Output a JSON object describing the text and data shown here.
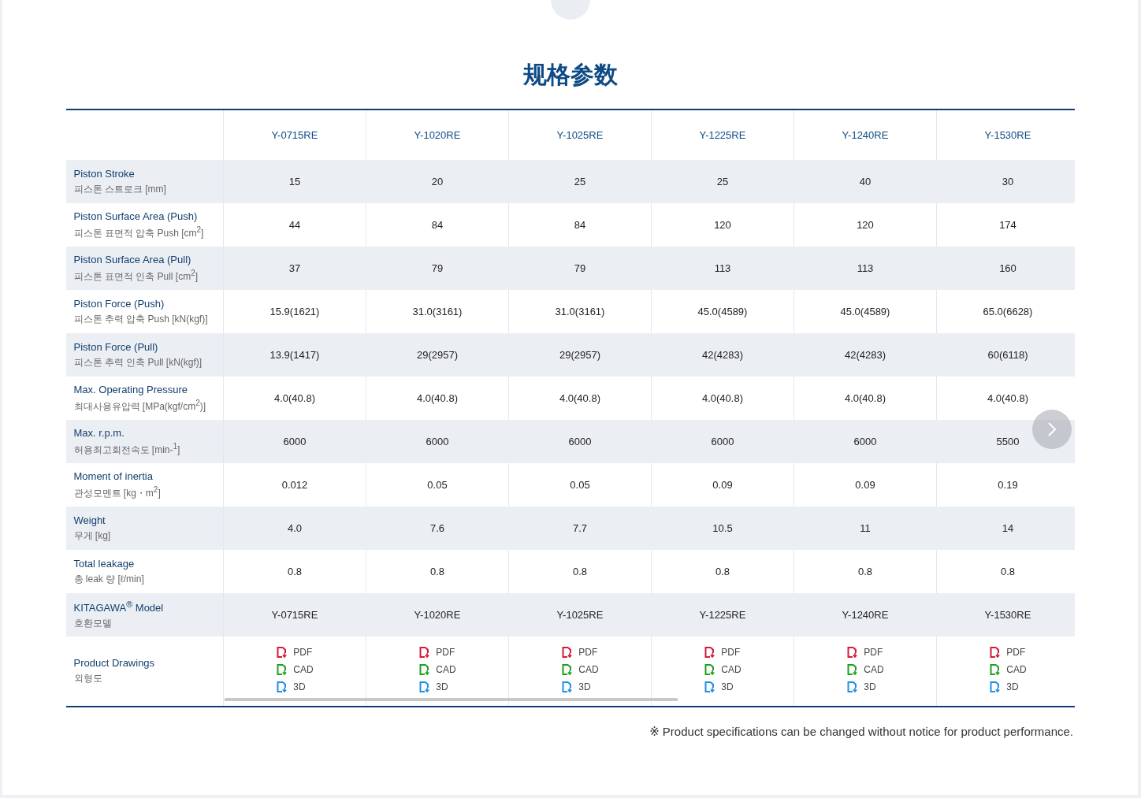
{
  "title": "规格参数",
  "columns": [
    "Y-0715RE",
    "Y-1020RE",
    "Y-1025RE",
    "Y-1225RE",
    "Y-1240RE",
    "Y-1530RE"
  ],
  "rows": [
    {
      "label": "Piston Stroke",
      "sublabel": "피스톤 스트로크 [mm]",
      "values": [
        "15",
        "20",
        "25",
        "25",
        "40",
        "30"
      ]
    },
    {
      "label": "Piston Surface Area (Push)",
      "sublabel": "피스톤 표면적 압축 Push [cm$^{2}$]",
      "values": [
        "44",
        "84",
        "84",
        "120",
        "120",
        "174"
      ]
    },
    {
      "label": "Piston Surface Area (Pull)",
      "sublabel": "피스톤 표면적 인축 Pull [cm$^{2}$]",
      "values": [
        "37",
        "79",
        "79",
        "113",
        "113",
        "160"
      ]
    },
    {
      "label": "Piston Force (Push)",
      "sublabel": "피스톤 추력 압축 Push [kN(kgf)]",
      "values": [
        "15.9(1621)",
        "31.0(3161)",
        "31.0(3161)",
        "45.0(4589)",
        "45.0(4589)",
        "65.0(6628)"
      ]
    },
    {
      "label": "Piston Force (Pull)",
      "sublabel": "피스톤 추력 인축 Pull [kN(kgf)]",
      "values": [
        "13.9(1417)",
        "29(2957)",
        "29(2957)",
        "42(4283)",
        "42(4283)",
        "60(6118)"
      ]
    },
    {
      "label": "Max. Operating Pressure",
      "sublabel": "최대사용유압력 [MPa(kgf/cm$^{2}$)]",
      "values": [
        "4.0(40.8)",
        "4.0(40.8)",
        "4.0(40.8)",
        "4.0(40.8)",
        "4.0(40.8)",
        "4.0(40.8)"
      ]
    },
    {
      "label": "Max. r.p.m.",
      "sublabel": "허용최고회전속도 [min-$^{1}$]",
      "values": [
        "6000",
        "6000",
        "6000",
        "6000",
        "6000",
        "5500"
      ]
    },
    {
      "label": "Moment of inertia",
      "sublabel": "관성모멘트 [kg・m$^{2}$]",
      "values": [
        "0.012",
        "0.05",
        "0.05",
        "0.09",
        "0.09",
        "0.19"
      ]
    },
    {
      "label": "Weight",
      "sublabel": "무게 [kg]",
      "values": [
        "4.0",
        "7.6",
        "7.7",
        "10.5",
        "11",
        "14"
      ]
    },
    {
      "label": "Total leakage",
      "sublabel": "총 leak 량 [ℓ/min]",
      "values": [
        "0.8",
        "0.8",
        "0.8",
        "0.8",
        "0.8",
        "0.8"
      ]
    },
    {
      "label": "KITAGAWA$^{®}$ Model",
      "sublabel": "호환모델",
      "values": [
        "Y-0715RE",
        "Y-1020RE",
        "Y-1025RE",
        "Y-1225RE",
        "Y-1240RE",
        "Y-1530RE"
      ]
    }
  ],
  "drawings": {
    "label": "Product Drawings",
    "sublabel": "외형도",
    "files": [
      [
        {
          "kind": "pdf",
          "text": "PDF"
        },
        {
          "kind": "cad",
          "text": "CAD"
        },
        {
          "kind": "model",
          "text": "3D"
        }
      ],
      [
        {
          "kind": "pdf",
          "text": "PDF"
        },
        {
          "kind": "cad",
          "text": "CAD"
        },
        {
          "kind": "model",
          "text": "3D"
        }
      ],
      [
        {
          "kind": "pdf",
          "text": "PDF"
        },
        {
          "kind": "cad",
          "text": "CAD"
        },
        {
          "kind": "model",
          "text": "3D"
        }
      ],
      [
        {
          "kind": "pdf",
          "text": "PDF"
        },
        {
          "kind": "cad",
          "text": "CAD"
        },
        {
          "kind": "model",
          "text": "3D"
        }
      ],
      [
        {
          "kind": "pdf",
          "text": "PDF"
        },
        {
          "kind": "cad",
          "text": "CAD"
        },
        {
          "kind": "model",
          "text": "3D"
        }
      ],
      [
        {
          "kind": "pdf",
          "text": "PDF"
        },
        {
          "kind": "cad",
          "text": "CAD"
        },
        {
          "kind": "model",
          "text": "3D"
        }
      ]
    ]
  },
  "note": "※ Product specifications can be changed without notice for product performance."
}
